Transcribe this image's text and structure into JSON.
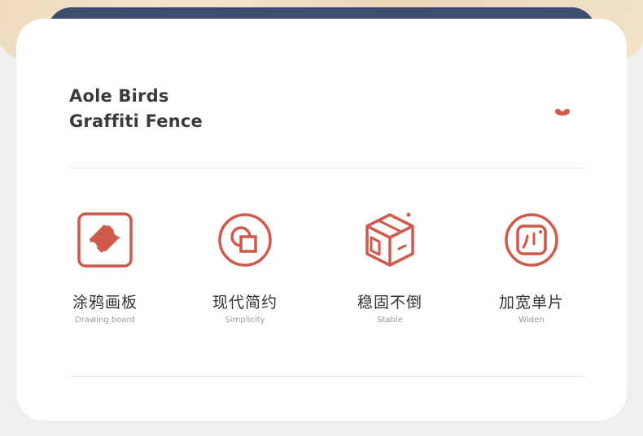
{
  "header": {
    "title_line1": "Aole Birds",
    "title_line2": "Graffiti Fence"
  },
  "colors": {
    "accent": "#cf5a4b",
    "navy": "#3e4c6e",
    "text": "#333333",
    "subtext": "#9a9a9a"
  },
  "features": [
    {
      "icon": "drawing-board-icon",
      "title_cn": "涂鸦画板",
      "title_en": "Drawing board"
    },
    {
      "icon": "overlapping-shapes-icon",
      "title_cn": "现代简约",
      "title_en": "Simplicity"
    },
    {
      "icon": "cube-icon",
      "title_cn": "稳固不倒",
      "title_en": "Stable"
    },
    {
      "icon": "widen-panel-icon",
      "title_cn": "加宽单片",
      "title_en": "Widen"
    }
  ]
}
